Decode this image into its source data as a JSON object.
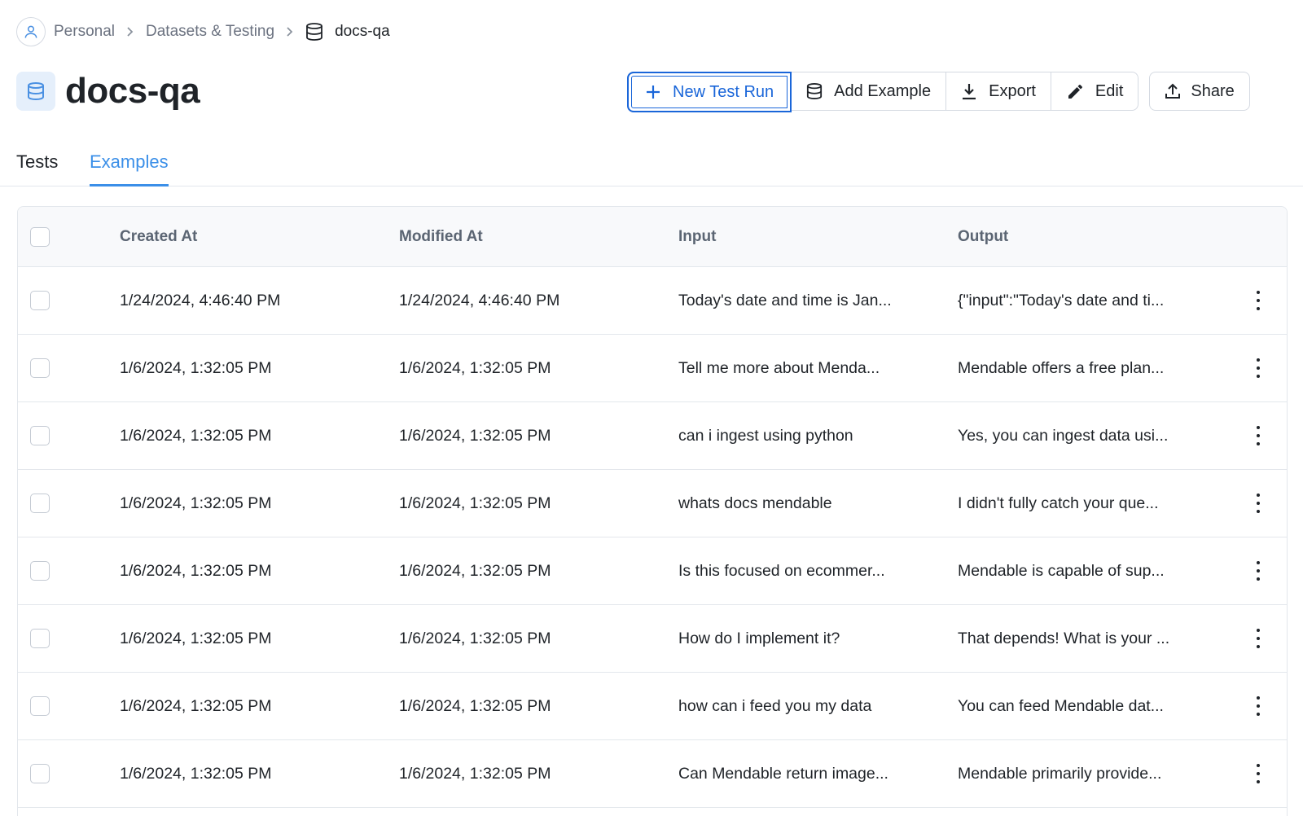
{
  "breadcrumb": {
    "items": [
      "Personal",
      "Datasets & Testing"
    ],
    "current": "docs-qa"
  },
  "page": {
    "title": "docs-qa"
  },
  "toolbar": {
    "new_test_run": "New Test Run",
    "add_example": "Add Example",
    "export": "Export",
    "edit": "Edit",
    "share": "Share"
  },
  "tabs": {
    "tests": "Tests",
    "examples": "Examples",
    "active": "Examples"
  },
  "table": {
    "columns": [
      "Created At",
      "Modified At",
      "Input",
      "Output"
    ],
    "rows": [
      {
        "created": "1/24/2024, 4:46:40 PM",
        "modified": "1/24/2024, 4:46:40 PM",
        "input": "Today's date and time is Jan...",
        "output": "{\"input\":\"Today's date and ti..."
      },
      {
        "created": "1/6/2024, 1:32:05 PM",
        "modified": "1/6/2024, 1:32:05 PM",
        "input": "Tell me more about Menda...",
        "output": "Mendable offers a free plan..."
      },
      {
        "created": "1/6/2024, 1:32:05 PM",
        "modified": "1/6/2024, 1:32:05 PM",
        "input": "can i ingest using python",
        "output": "Yes, you can ingest data usi..."
      },
      {
        "created": "1/6/2024, 1:32:05 PM",
        "modified": "1/6/2024, 1:32:05 PM",
        "input": "whats docs mendable",
        "output": "I didn't fully catch your que..."
      },
      {
        "created": "1/6/2024, 1:32:05 PM",
        "modified": "1/6/2024, 1:32:05 PM",
        "input": "Is this focused on ecommer...",
        "output": "Mendable is capable of sup..."
      },
      {
        "created": "1/6/2024, 1:32:05 PM",
        "modified": "1/6/2024, 1:32:05 PM",
        "input": "How do I implement it?",
        "output": "That depends! What is your ..."
      },
      {
        "created": "1/6/2024, 1:32:05 PM",
        "modified": "1/6/2024, 1:32:05 PM",
        "input": "how can i feed you my data",
        "output": "You can feed Mendable dat..."
      },
      {
        "created": "1/6/2024, 1:32:05 PM",
        "modified": "1/6/2024, 1:32:05 PM",
        "input": "Can Mendable return image...",
        "output": "Mendable primarily provide..."
      }
    ]
  },
  "colors": {
    "accent": "#1a66d9",
    "tab_active": "#3b8fe8",
    "border": "#e3e7ec",
    "header_bg": "#f8f9fb"
  },
  "icons": [
    "user-icon",
    "chevron-right-icon",
    "database-icon",
    "plus-icon",
    "download-icon",
    "pencil-icon",
    "upload-icon",
    "more-vertical-icon"
  ]
}
